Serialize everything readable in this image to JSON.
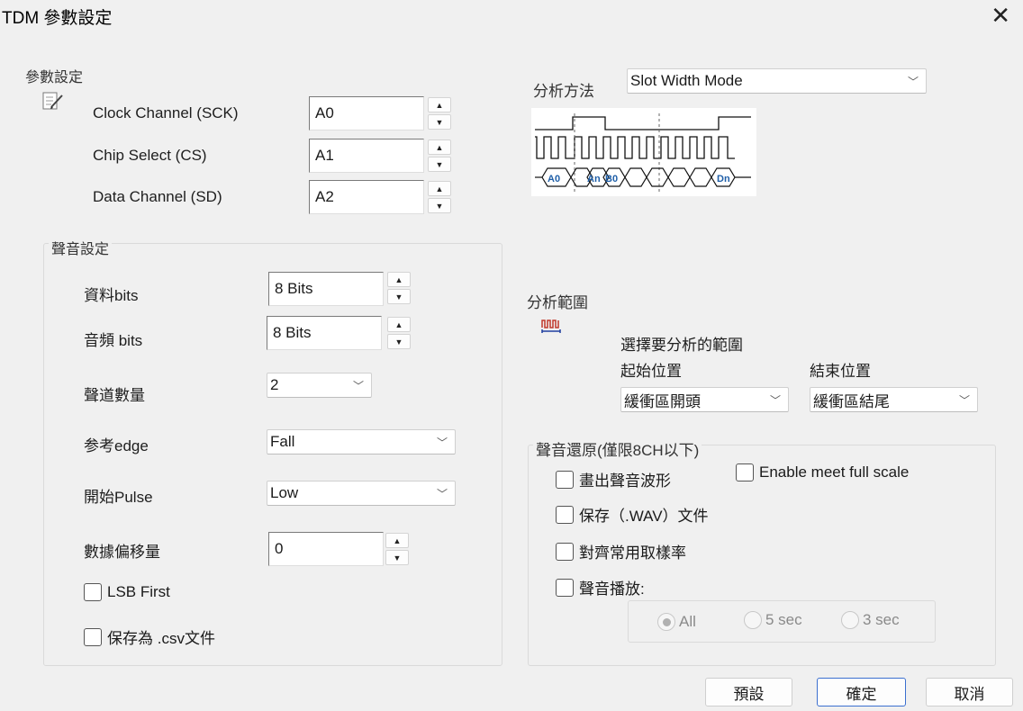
{
  "window": {
    "title": "TDM 參數設定",
    "close_glyph": "✕"
  },
  "params": {
    "section_label": "參數設定",
    "icon": "notepad-edit-icon",
    "fields": [
      {
        "label": "Clock Channel (SCK)",
        "value": "A0"
      },
      {
        "label": "Chip Select (CS)",
        "value": "A1"
      },
      {
        "label": "Data Channel (SD)",
        "value": "A2"
      }
    ]
  },
  "sound": {
    "section_label": "聲音設定",
    "data_bits": {
      "label": "資料bits",
      "value": "8 Bits"
    },
    "audio_bits": {
      "label": "音頻 bits",
      "value": "8 Bits"
    },
    "channels": {
      "label": "聲道數量",
      "value": "2"
    },
    "edge": {
      "label": "参考edge",
      "value": "Fall"
    },
    "pulse": {
      "label": "開始Pulse",
      "value": "Low"
    },
    "offset": {
      "label": "數據偏移量",
      "value": "0"
    },
    "lsb_first": {
      "label": "LSB First",
      "checked": false
    },
    "save_csv": {
      "label": "保存為 .csv文件",
      "checked": false
    }
  },
  "analysis": {
    "method_label": "分析方法",
    "method_value": "Slot Width Mode",
    "diagram_labels": [
      "A0",
      "An",
      "B0",
      "Dn"
    ],
    "diagram_color": "#1f5fa8"
  },
  "range": {
    "label": "分析範圍",
    "icon": "waveform-range-icon",
    "select_label": "選擇要分析的範圍",
    "start_label": "起始位置",
    "start_value": "緩衝區開頭",
    "end_label": "結束位置",
    "end_value": "緩衝區結尾"
  },
  "restore": {
    "group_label": "聲音還原(僅限8CH以下)",
    "draw_wave": "畫出聲音波形",
    "full_scale": "Enable meet full scale",
    "save_wav": "保存（.WAV）文件",
    "align_rate": "對齊常用取樣率",
    "playback": "聲音播放:",
    "radio_all": "All",
    "radio_5": "5 sec",
    "radio_3": "3 sec",
    "selected_radio": "All"
  },
  "buttons": {
    "default": "預設",
    "ok": "確定",
    "cancel": "取消"
  },
  "colors": {
    "primary_border": "#3b6fcf",
    "background": "#f0f0f0"
  }
}
